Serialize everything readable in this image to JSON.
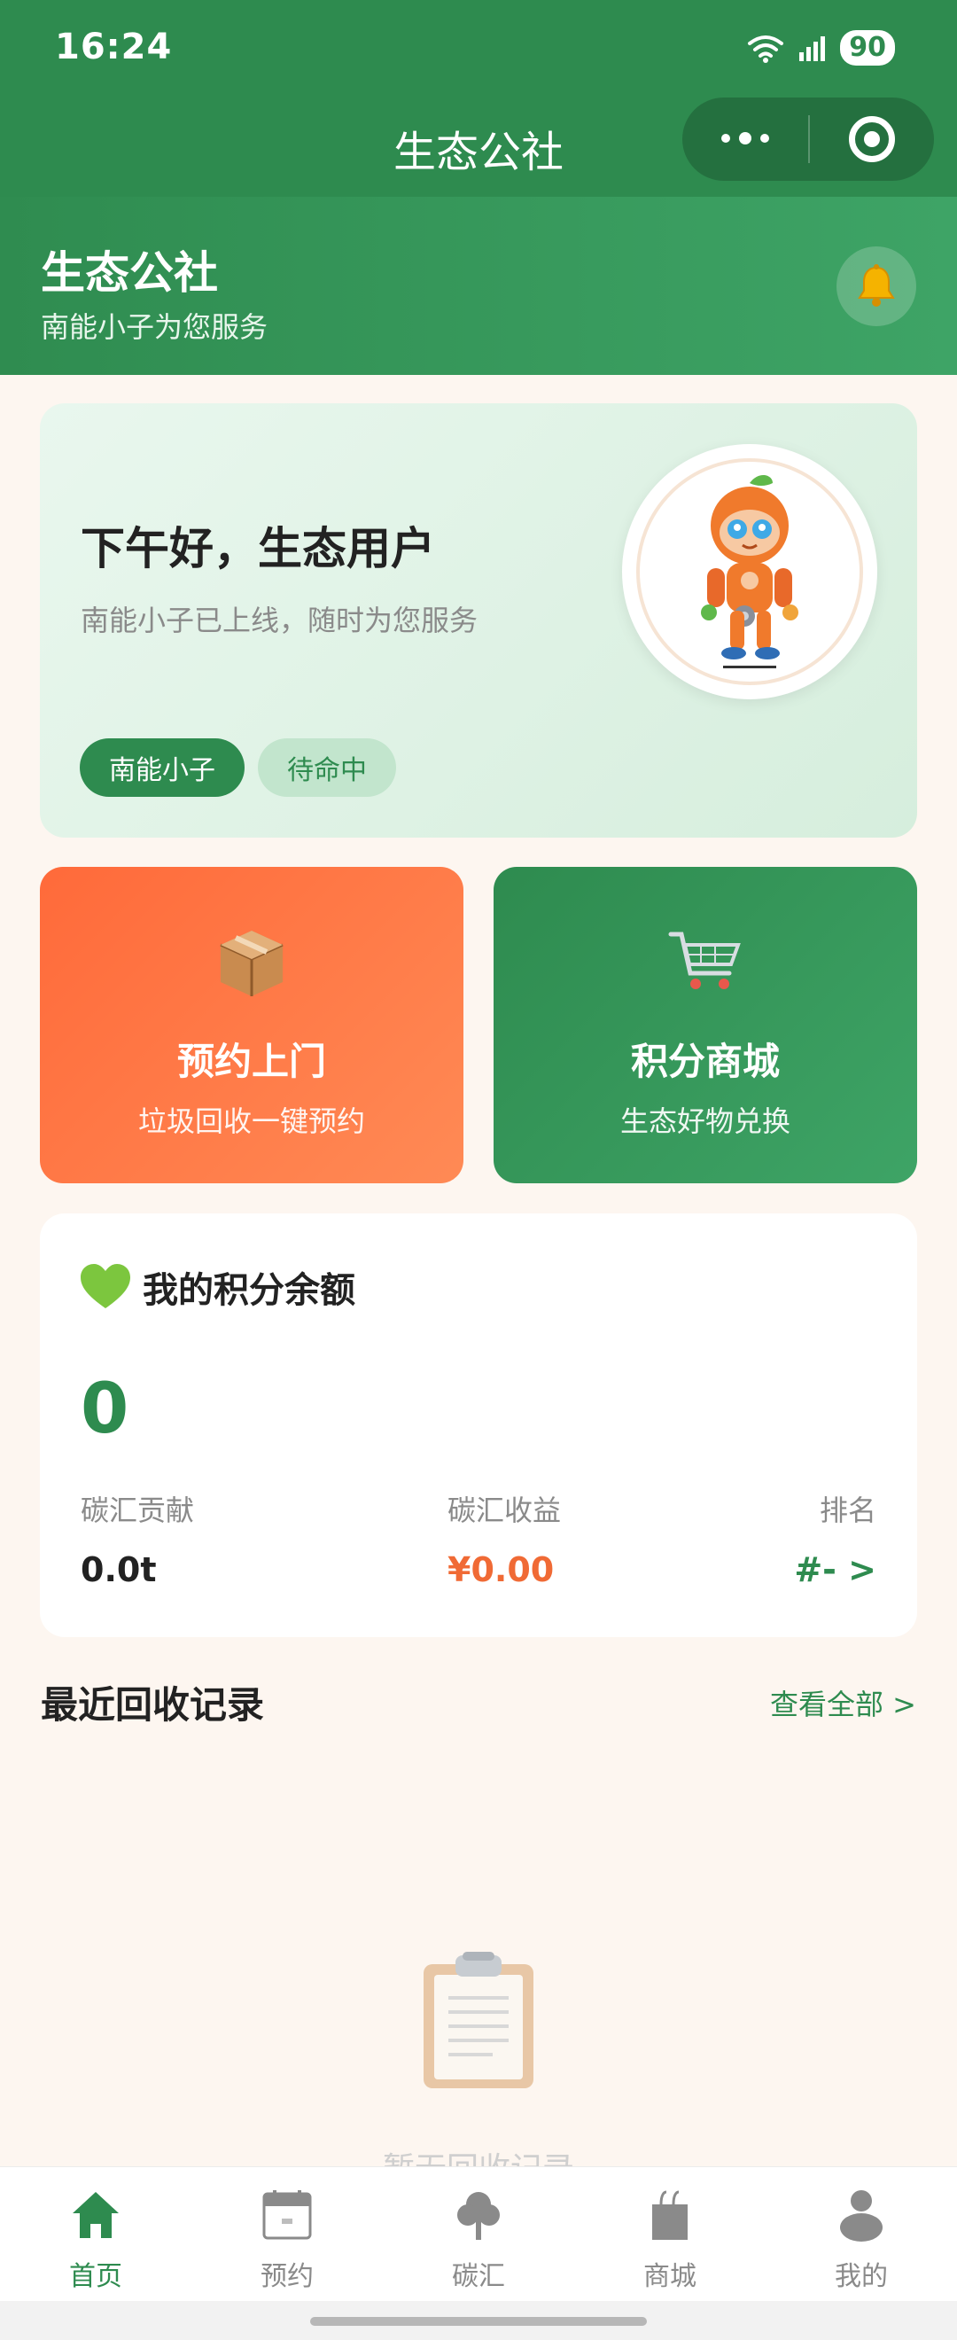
{
  "status_bar": {
    "time": "16:24",
    "battery": "90"
  },
  "nav": {
    "title": "生态公社"
  },
  "header": {
    "title": "生态公社",
    "subtitle": "南能小子为您服务"
  },
  "welcome": {
    "greeting": "下午好，生态用户",
    "subtitle": "南能小子已上线，随时为您服务",
    "tags": [
      "南能小子",
      "待命中"
    ]
  },
  "actions": [
    {
      "title": "预约上门",
      "subtitle": "垃圾回收一键预约",
      "icon": "package-icon"
    },
    {
      "title": "积分商城",
      "subtitle": "生态好物兑换",
      "icon": "shopping-cart-icon"
    }
  ],
  "points": {
    "title": "我的积分余额",
    "value": "0",
    "stats": [
      {
        "label": "碳汇贡献",
        "value": "0.0t"
      },
      {
        "label": "碳汇收益",
        "value": "¥0.00"
      },
      {
        "label": "排名",
        "value": "#- >"
      }
    ]
  },
  "recent": {
    "title": "最近回收记录",
    "view_all": "查看全部 >",
    "empty_text": "暂无回收记录"
  },
  "tabbar": [
    {
      "label": "首页",
      "icon": "home-icon",
      "active": true
    },
    {
      "label": "预约",
      "icon": "calendar-icon",
      "active": false
    },
    {
      "label": "碳汇",
      "icon": "tree-icon",
      "active": false
    },
    {
      "label": "商城",
      "icon": "shopping-bag-icon",
      "active": false
    },
    {
      "label": "我的",
      "icon": "user-icon",
      "active": false
    }
  ],
  "colors": {
    "primary": "#2e8b4f",
    "orange": "#ff6a3a",
    "money": "#f06a35",
    "background": "#fdf6f0"
  }
}
